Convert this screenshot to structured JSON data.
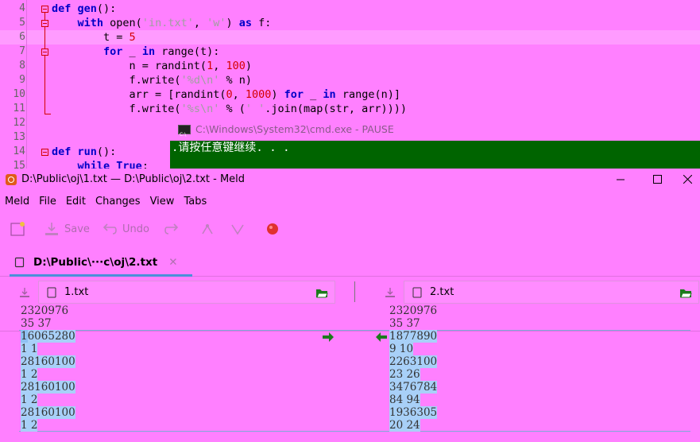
{
  "editor": {
    "lines": [
      {
        "num": "4",
        "text": "def gen():"
      },
      {
        "num": "5",
        "text": "    with open('in.txt', 'w') as f:"
      },
      {
        "num": "6",
        "text": "        t = 5"
      },
      {
        "num": "7",
        "text": "        for _ in range(t):"
      },
      {
        "num": "8",
        "text": "            n = randint(1, 100)"
      },
      {
        "num": "9",
        "text": "            f.write('%d\\n' % n)"
      },
      {
        "num": "10",
        "text": "            arr = [randint(0, 1000) for _ in range(n)]"
      },
      {
        "num": "11",
        "text": "            f.write('%s\\n' % (' '.join(map(str, arr))))"
      },
      {
        "num": "12",
        "text": ""
      },
      {
        "num": "13",
        "text": ""
      },
      {
        "num": "14",
        "text": "def run():"
      },
      {
        "num": "15",
        "text": "    while True:"
      }
    ]
  },
  "cmd": {
    "title": "C:\\Windows\\System32\\cmd.exe - PAUSE",
    "output": ".请按任意键继续. . ."
  },
  "meld": {
    "title": "D:\\Public\\oj\\1.txt — D:\\Public\\oj\\2.txt - Meld",
    "menu": [
      "Meld",
      "File",
      "Edit",
      "Changes",
      "View",
      "Tabs"
    ],
    "toolbar": {
      "save": "Save",
      "undo": "Undo"
    },
    "tab_label": "D:\\Public\\···c\\oj\\2.txt",
    "left_file": "1.txt",
    "right_file": "2.txt",
    "left_lines": [
      "2320976",
      "35 37",
      "16065280",
      "1 1",
      "28160100",
      "1 2",
      "28160100",
      "1 2",
      "28160100",
      "1 2"
    ],
    "right_lines": [
      "2320976",
      "35 37",
      "1877890",
      "9 10",
      "2263100",
      "23 26",
      "3476784",
      "84 94",
      "1936305",
      "20 24"
    ],
    "colors": {
      "accent": "#4a90d9",
      "change_bg": "#8ec0f2",
      "arrow": "#1c7a1c",
      "record": "#e03030"
    }
  }
}
